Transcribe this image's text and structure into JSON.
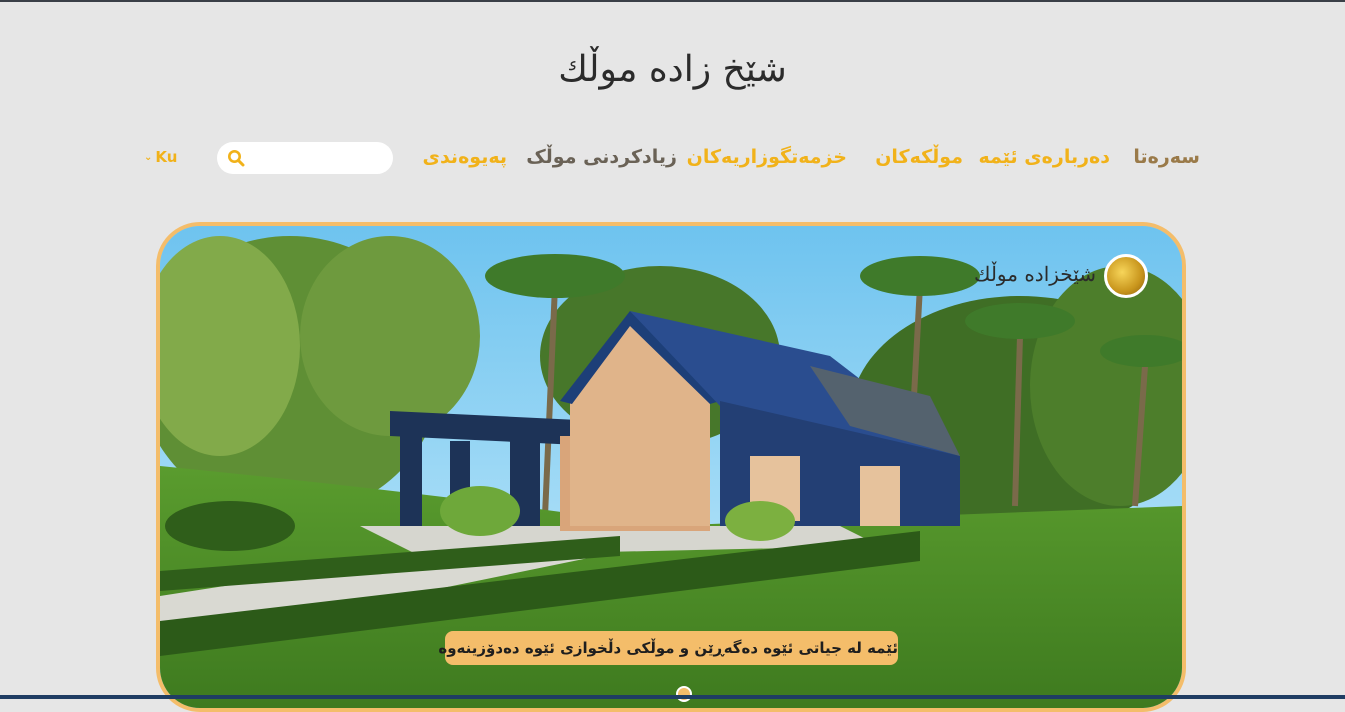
{
  "header": {
    "site_title": "شێخ زادە موڵك"
  },
  "nav": {
    "items": [
      {
        "label": "سەرەتا"
      },
      {
        "label": "دەربارەی ئێمە"
      },
      {
        "label": "موڵکەکان"
      },
      {
        "label": "خزمەتگوزاریەکان"
      },
      {
        "label": "زیادکردنی موڵک"
      },
      {
        "label": "پەیوەندی"
      }
    ],
    "search_placeholder": "",
    "search_value": "",
    "language": "Ku",
    "icons": {
      "search": "search-icon",
      "language_dropdown": "chevron-down-icon"
    }
  },
  "hero": {
    "logo_text": "شێخزادە موڵك",
    "caption": "ئێمە لە جیاتی ئێوە دەگەڕێن و موڵکی دڵخوازی ئێوە دەدۆزینەوە",
    "image": "modern-house-photo",
    "slide_indicator": "slider-dot-active"
  },
  "colors": {
    "accent": "#f1b21a",
    "nav_active": "#9a7a49",
    "frame": "#f4bd6a",
    "page_bg": "#e6e6e6"
  }
}
